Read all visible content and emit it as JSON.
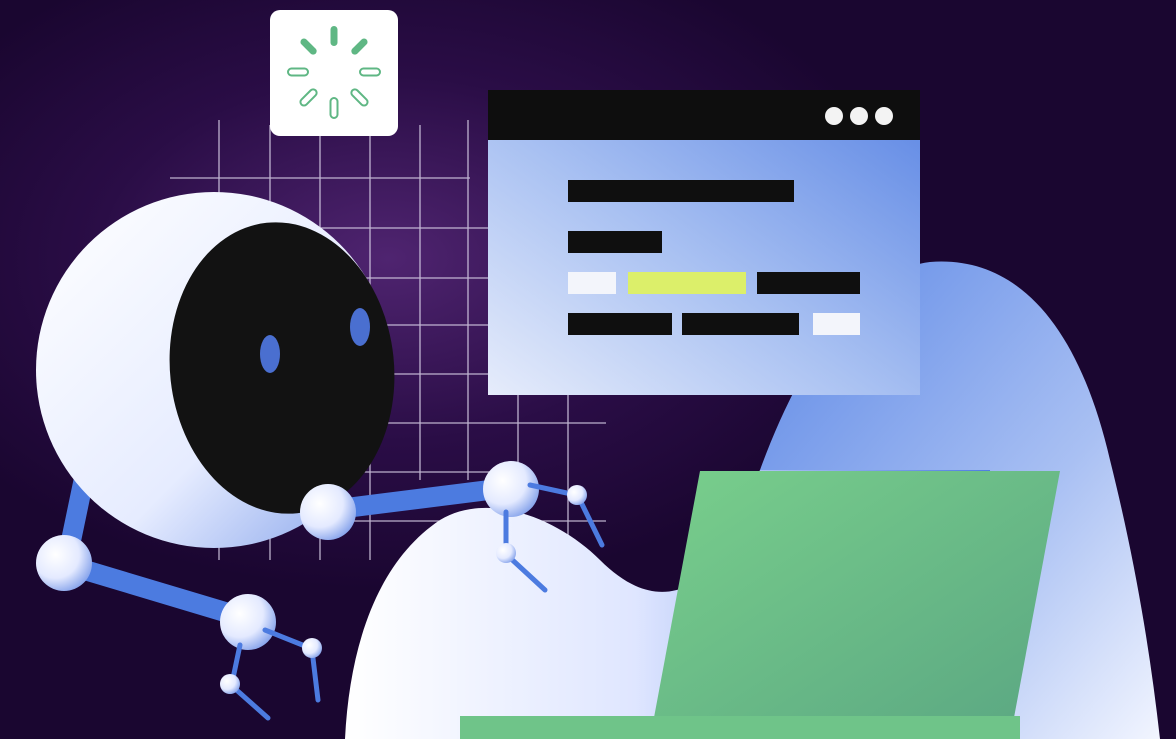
{
  "illustration": {
    "subject": "robot-using-laptop",
    "colors": {
      "background": "#1a0630",
      "glow": "#5a2a78",
      "robot_white": "#f3f6ff",
      "robot_blue": "#4c7be0",
      "visor": "#121212",
      "laptop_green": "#6fc489",
      "spinner_green": "#5fb784",
      "window_bar": "#0e0e0e",
      "window_body": "#8fb0ee",
      "highlight_yellow": "#dcef6a",
      "grid_line": "#d8cfe6"
    },
    "icons": {
      "loading": "loading-spinner-icon",
      "window_controls": "three-dots-icon"
    }
  }
}
